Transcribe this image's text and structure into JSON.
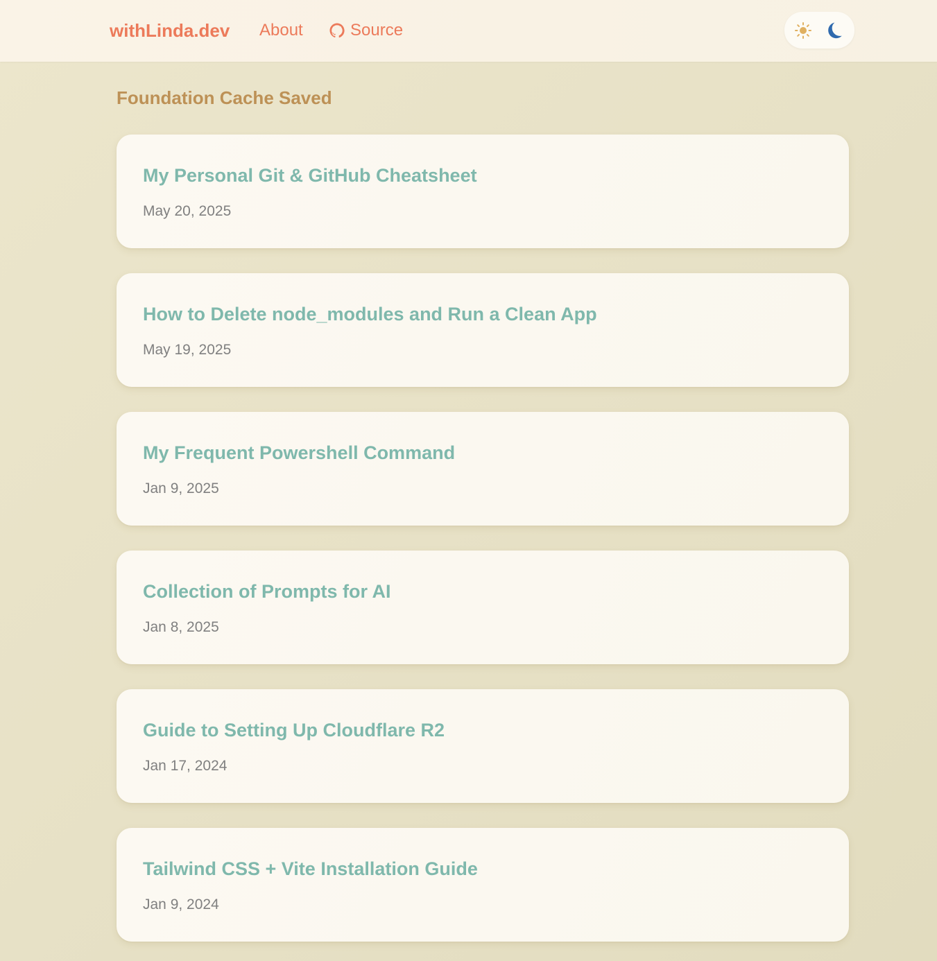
{
  "header": {
    "brand": "withLinda.dev",
    "nav": {
      "about": "About",
      "source": "Source"
    },
    "theme_toggle": {
      "light_icon": "sun-icon",
      "dark_icon": "moon-icon"
    }
  },
  "main": {
    "section_title": "Foundation Cache Saved",
    "posts": [
      {
        "title": "My Personal Git & GitHub Cheatsheet",
        "date": "May 20, 2025"
      },
      {
        "title": "How to Delete node_modules and Run a Clean App",
        "date": "May 19, 2025"
      },
      {
        "title": "My Frequent Powershell Command",
        "date": "Jan 9, 2025"
      },
      {
        "title": "Collection of Prompts for AI",
        "date": "Jan 8, 2025"
      },
      {
        "title": "Guide to Setting Up Cloudflare R2",
        "date": "Jan 17, 2024"
      },
      {
        "title": "Tailwind CSS + Vite Installation Guide",
        "date": "Jan 9, 2024"
      }
    ]
  },
  "colors": {
    "brand": "#ec7a5a",
    "section_title": "#bd9156",
    "post_title": "#7fb8ac",
    "date": "#808080",
    "moon": "#2f6aae",
    "sun": "#e0b060"
  }
}
